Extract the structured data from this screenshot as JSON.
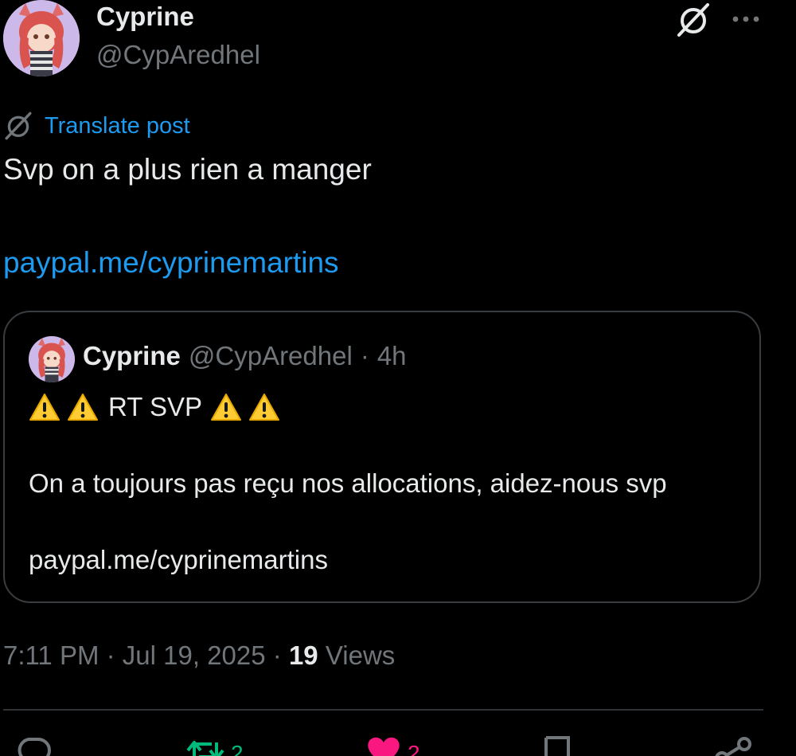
{
  "post": {
    "author": {
      "display_name": "Cyprine",
      "handle": "@CypAredhel"
    },
    "header_icons": {
      "grok": "grok-icon",
      "more": "more-icon"
    },
    "translate_label": "Translate post",
    "text": "Svp on a plus rien a manger",
    "link": "paypal.me/cyprinemartins",
    "quote": {
      "display_name": "Cyprine",
      "handle": "@CypAredhel",
      "separator": "·",
      "time": "4h",
      "line1": "RT SVP",
      "line1_emoji": "warning-sign",
      "line2": "On a toujours pas reçu nos allocations, aidez-nous svp",
      "line3": "paypal.me/cyprinemartins"
    },
    "meta": {
      "time": "7:11 PM",
      "separator": "·",
      "date": "Jul 19, 2025",
      "views_count": "19",
      "views_label": "Views"
    },
    "actions": {
      "reply_icon": "reply-icon",
      "repost_icon": "repost-icon",
      "repost_count": "2",
      "like_icon": "heart-icon",
      "like_count": "2",
      "bookmark_icon": "bookmark-icon",
      "share_icon": "share-icon"
    }
  },
  "colors": {
    "background": "#000000",
    "text": "#e7e9ea",
    "secondary_text": "#71767b",
    "link": "#1d9bf0",
    "repost_active": "#00ba7c",
    "like_active": "#f91880",
    "border": "#2f3336"
  }
}
